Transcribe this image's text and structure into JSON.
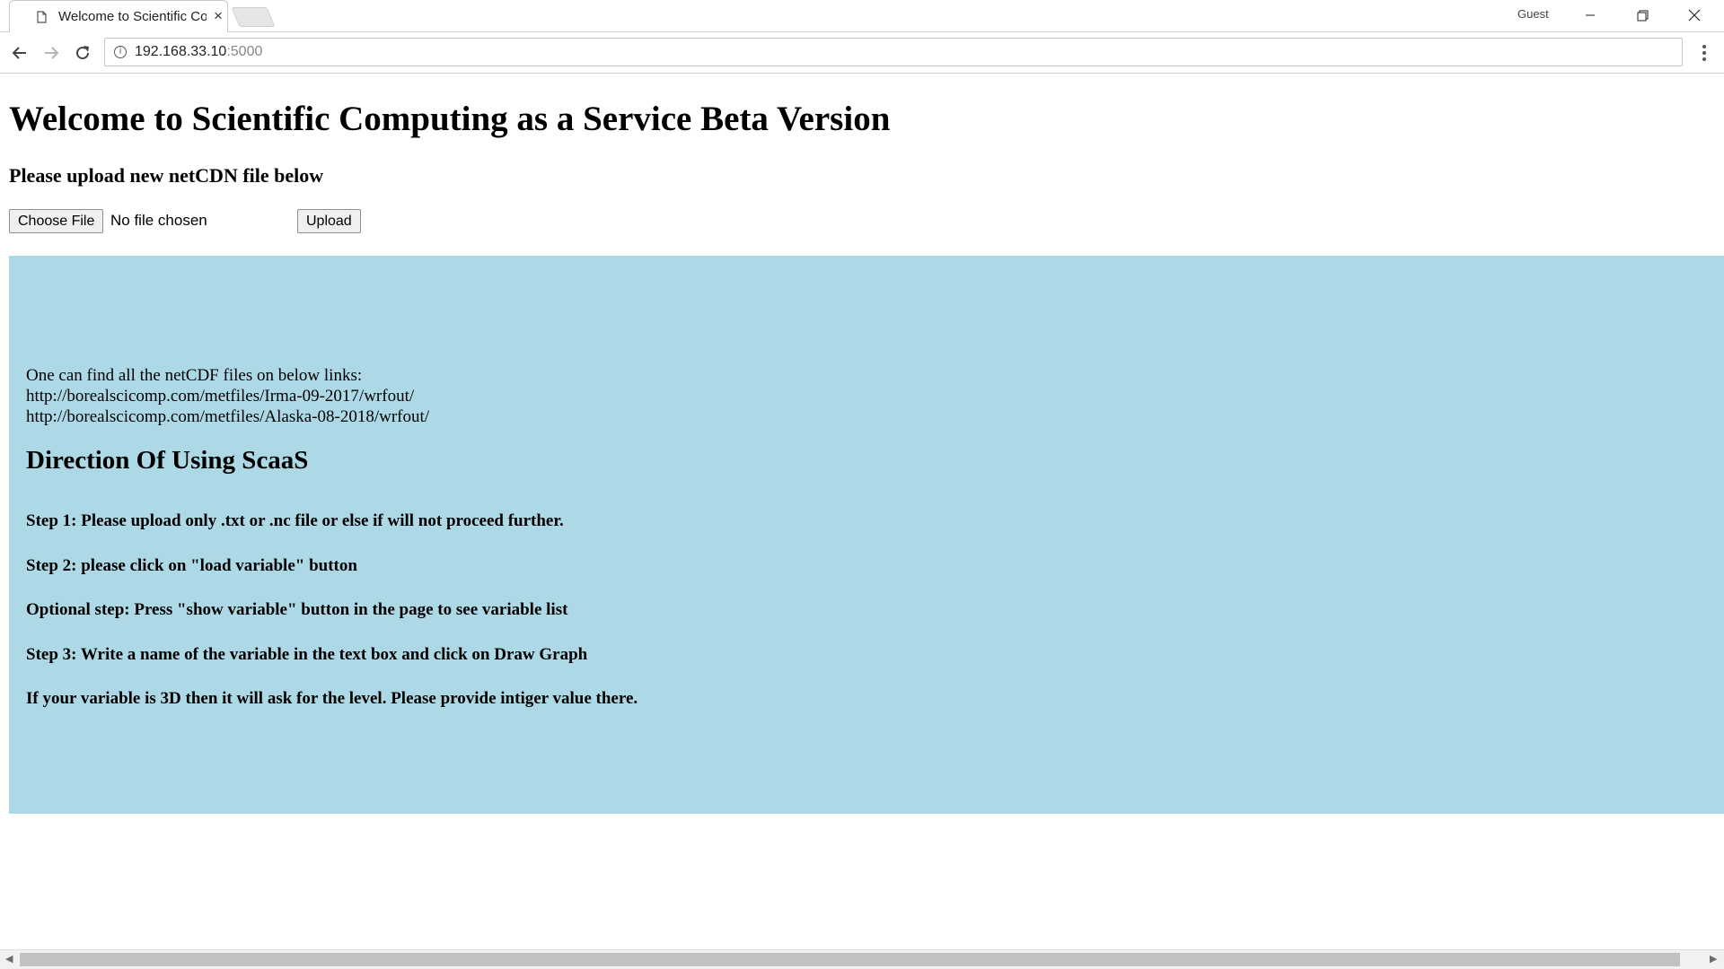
{
  "browser": {
    "tab_title": "Welcome to Scientific Computing as a Service Beta Version",
    "profile_label": "Guest",
    "url_host": "192.168.33.10",
    "url_port": ":5000",
    "tab_close_glyph": "×"
  },
  "page": {
    "title": "Welcome to Scientific Computing as a Service Beta Version",
    "upload_prompt": "Please upload new netCDN file below",
    "choose_file_label": "Choose File",
    "file_status": "No file chosen",
    "upload_label": "Upload",
    "links_intro": "One can find all the netCDF files on below links:",
    "links": [
      "http://borealscicomp.com/metfiles/Irma-09-2017/wrfout/",
      "http://borealscicomp.com/metfiles/Alaska-08-2018/wrfout/"
    ],
    "directions_heading": "Direction Of Using ScaaS",
    "steps": [
      "Step 1: Please upload only .txt or .nc file or else if will not proceed further.",
      "Step 2: please click on \"load variable\" button",
      "Optional step: Press \"show variable\" button in the page to see variable list",
      "Step 3: Write a name of the variable in the text box and click on Draw Graph",
      "If your variable is 3D then it will ask for the level. Please provide intiger value there."
    ],
    "panel_color": "#add8e6"
  },
  "icons": {
    "tab_icon": "page-icon",
    "back": "back-arrow-icon",
    "forward": "forward-arrow-icon",
    "reload": "reload-icon",
    "info": "info-icon",
    "menu": "kebab-menu-icon"
  }
}
